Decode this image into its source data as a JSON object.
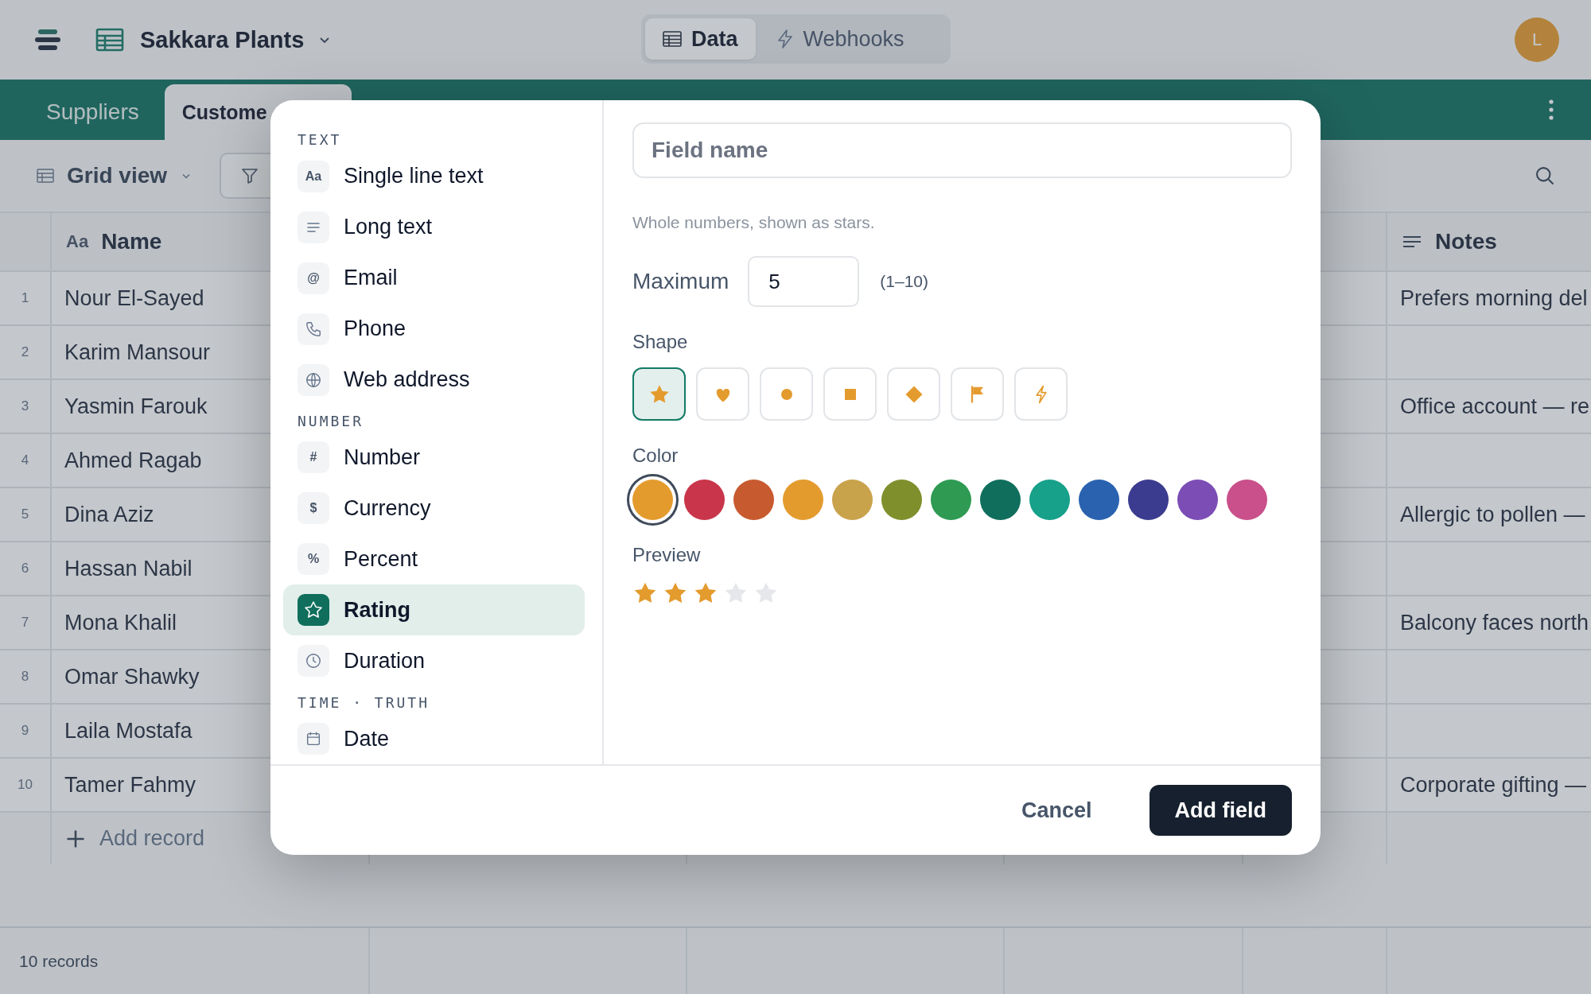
{
  "app": {
    "title": "Sakkara Plants"
  },
  "views": [
    {
      "label": "Data",
      "kind": "table",
      "selected": true
    },
    {
      "label": "Webhooks",
      "kind": "bolt",
      "selected": false
    }
  ],
  "avatar": {
    "initial": "L"
  },
  "table_tabs": [
    {
      "label": "Suppliers",
      "selected": false
    },
    {
      "label": "Custome",
      "selected": true
    }
  ],
  "toolbar": {
    "view": "Grid view"
  },
  "table": {
    "columns": [
      {
        "label": "Name",
        "glyph": "Aa"
      },
      {
        "label": "Notes"
      }
    ],
    "rows": [
      {
        "number": "1",
        "name": "Nour El-Sayed",
        "notes": "Prefers morning del"
      },
      {
        "number": "2",
        "name": "Karim Mansour"
      },
      {
        "number": "3",
        "name": "Yasmin Farouk",
        "notes": "Office account — re"
      },
      {
        "number": "4",
        "name": "Ahmed Ragab"
      },
      {
        "number": "5",
        "name": "Dina Aziz",
        "notes": "Allergic to pollen —"
      },
      {
        "number": "6",
        "name": "Hassan Nabil"
      },
      {
        "number": "7",
        "name": "Mona Khalil",
        "notes": "Balcony faces north"
      },
      {
        "number": "8",
        "name": "Omar Shawky"
      },
      {
        "number": "9",
        "name": "Laila Mostafa"
      },
      {
        "number": "10",
        "name": "Tamer Fahmy",
        "notes": "Corporate gifting —"
      }
    ],
    "add_record": "Add record"
  },
  "status_bar": {
    "count": "10 records"
  },
  "dialog": {
    "sections": [
      {
        "heading": "TEXT",
        "items": [
          {
            "label": "Single line text",
            "kind": "glyph",
            "glyph": "Aa",
            "selected": false
          },
          {
            "label": "Long text",
            "kind": "lines",
            "selected": false
          },
          {
            "label": "Email",
            "kind": "glyph",
            "glyph": "@",
            "selected": false
          },
          {
            "label": "Phone",
            "kind": "phone",
            "selected": false
          },
          {
            "label": "Web address",
            "kind": "globe",
            "selected": false
          }
        ]
      },
      {
        "heading": "NUMBER",
        "items": [
          {
            "label": "Number",
            "kind": "glyph",
            "glyph": "#",
            "selected": false
          },
          {
            "label": "Currency",
            "kind": "glyph",
            "glyph": "$",
            "selected": false
          },
          {
            "label": "Percent",
            "kind": "glyph",
            "glyph": "%",
            "selected": false
          },
          {
            "label": "Rating",
            "kind": "star",
            "selected": true
          },
          {
            "label": "Duration",
            "kind": "clock",
            "selected": false
          }
        ]
      },
      {
        "heading": "TIME · TRUTH",
        "items": [
          {
            "label": "Date",
            "kind": "calendar",
            "selected": false
          }
        ]
      }
    ],
    "field_name": {
      "placeholder": "Field name"
    },
    "hint": "Whole numbers, shown as stars.",
    "maximum": {
      "label": "Maximum",
      "value": "5",
      "range": "(1–10)"
    },
    "shape": {
      "label": "Shape",
      "options": [
        {
          "kind": "star",
          "selected": true
        },
        {
          "kind": "heart",
          "selected": false
        },
        {
          "kind": "circle",
          "selected": false
        },
        {
          "kind": "square",
          "selected": false
        },
        {
          "kind": "diamond",
          "selected": false
        },
        {
          "kind": "flag",
          "selected": false
        },
        {
          "kind": "bolt",
          "selected": false
        }
      ]
    },
    "color": {
      "label": "Color",
      "options": [
        {
          "color": "#e49b2e",
          "selected": true
        },
        {
          "color": "#c9354a",
          "selected": false
        },
        {
          "color": "#c85a2f",
          "selected": false
        },
        {
          "color": "#e49b2e",
          "selected": false
        },
        {
          "color": "#c9a24c",
          "selected": false
        },
        {
          "color": "#7f8f2c",
          "selected": false
        },
        {
          "color": "#2e9a52",
          "selected": false
        },
        {
          "color": "#0f6e5c",
          "selected": false
        },
        {
          "color": "#17a08a",
          "selected": false
        },
        {
          "color": "#2a62b0",
          "selected": false
        },
        {
          "color": "#3b3b8f",
          "selected": false
        },
        {
          "color": "#7b4db5",
          "selected": false
        },
        {
          "color": "#c9508a",
          "selected": false
        }
      ]
    },
    "preview": {
      "label": "Preview",
      "stars": 3
    },
    "buttons": [
      {
        "label": "Cancel",
        "kind": "secondary"
      },
      {
        "label": "Add field",
        "kind": "primary"
      }
    ]
  }
}
